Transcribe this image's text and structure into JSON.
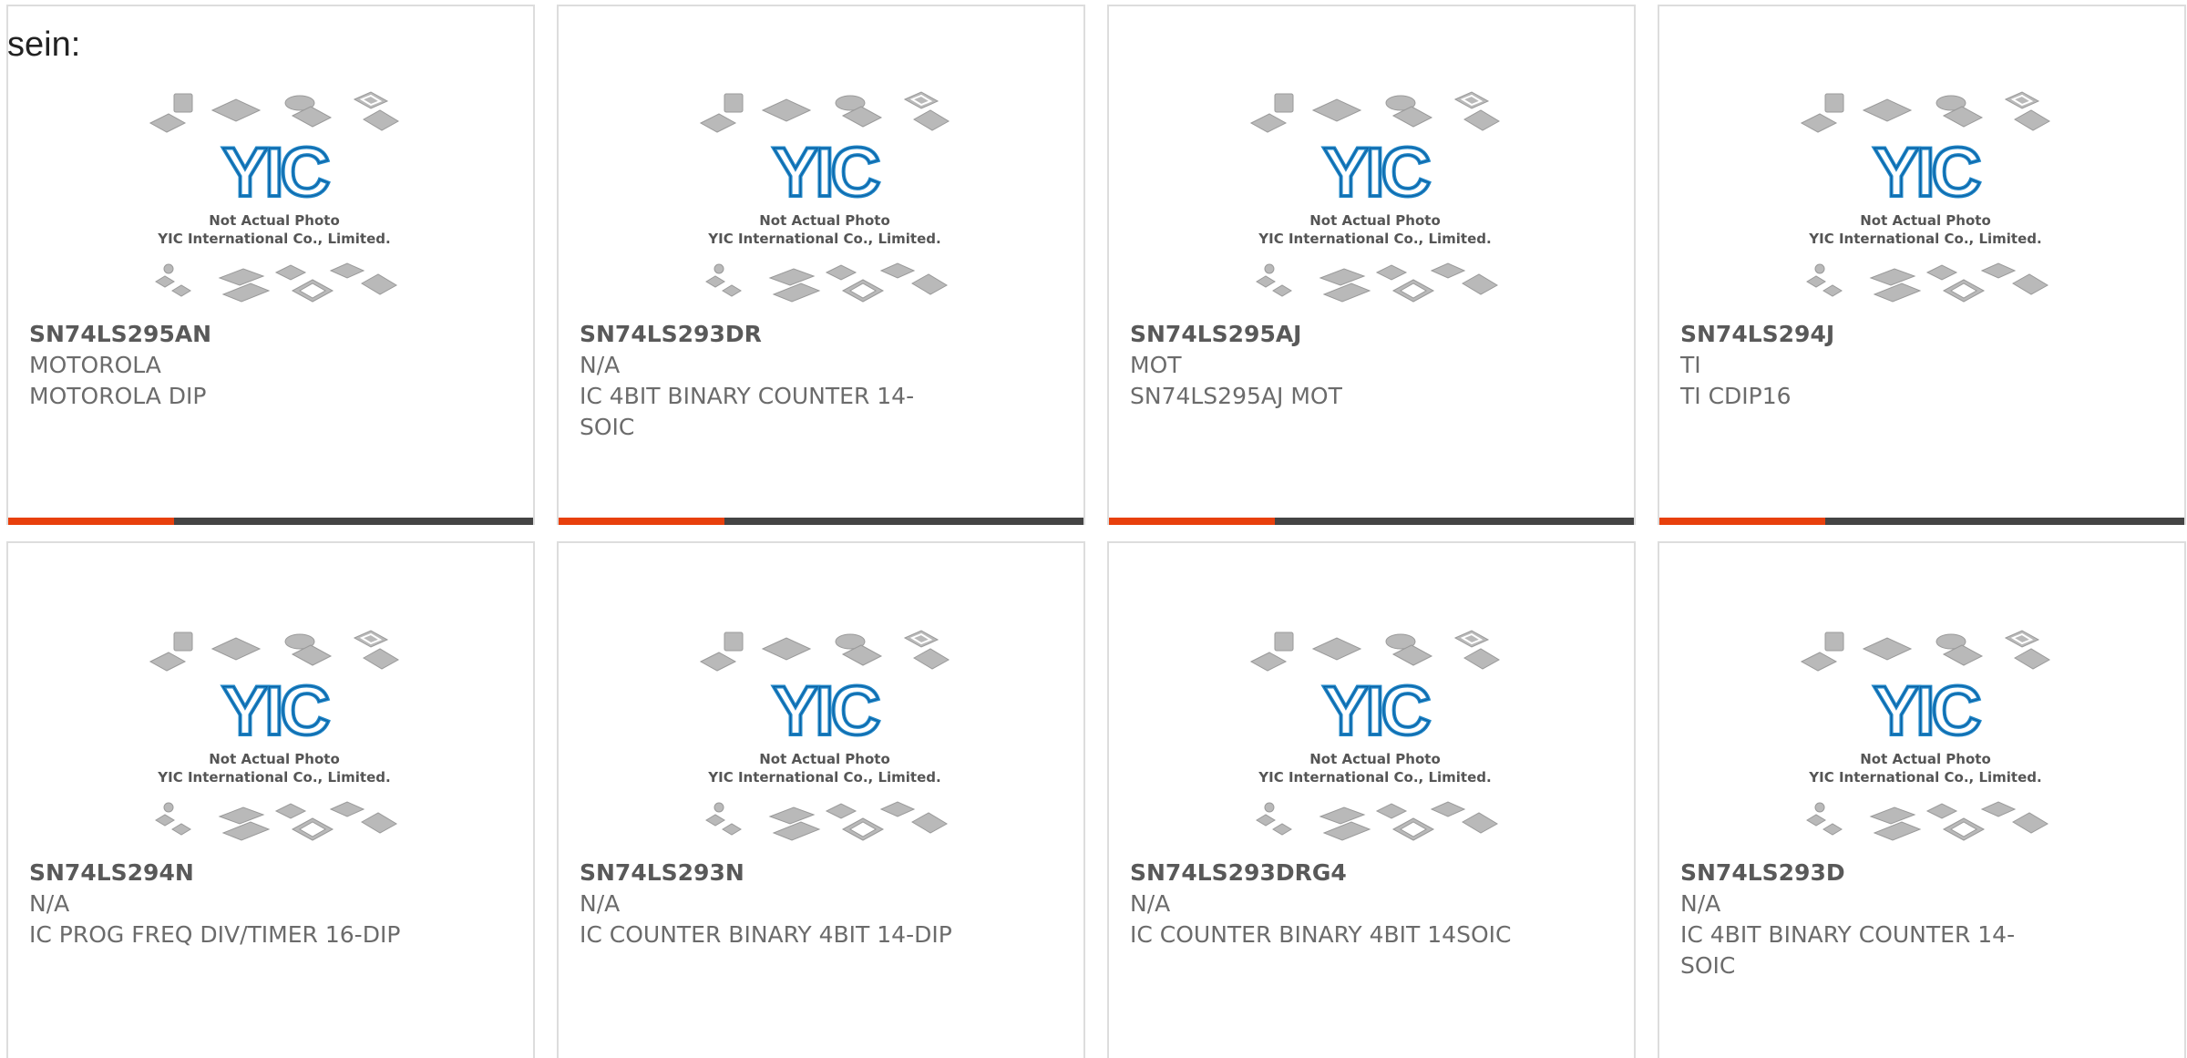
{
  "intro_text": "sein:",
  "photo_caption": {
    "line1": "Not Actual Photo",
    "line2": "YIC International Co., Limited.",
    "logo_text": "YIC"
  },
  "colors": {
    "accent_bar": "#e8400c",
    "dark_bar": "#444444",
    "logo_blue": "#1e84c6",
    "card_border": "#dddddd"
  },
  "products": [
    {
      "part_number": "SN74LS295AN",
      "manufacturer": "MOTOROLA",
      "description": "MOTOROLA DIP"
    },
    {
      "part_number": "SN74LS293DR",
      "manufacturer": "N/A",
      "description": "IC 4BIT BINARY COUNTER 14-SOIC"
    },
    {
      "part_number": "SN74LS295AJ",
      "manufacturer": "MOT",
      "description": "SN74LS295AJ MOT"
    },
    {
      "part_number": "SN74LS294J",
      "manufacturer": "TI",
      "description": "TI CDIP16"
    },
    {
      "part_number": "SN74LS294N",
      "manufacturer": "N/A",
      "description": "IC PROG FREQ DIV/TIMER 16-DIP"
    },
    {
      "part_number": "SN74LS293N",
      "manufacturer": "N/A",
      "description": "IC COUNTER BINARY 4BIT 14-DIP"
    },
    {
      "part_number": "SN74LS293DRG4",
      "manufacturer": "N/A",
      "description": "IC COUNTER BINARY 4BIT 14SOIC"
    },
    {
      "part_number": "SN74LS293D",
      "manufacturer": "N/A",
      "description": "IC 4BIT BINARY COUNTER 14-SOIC"
    }
  ]
}
